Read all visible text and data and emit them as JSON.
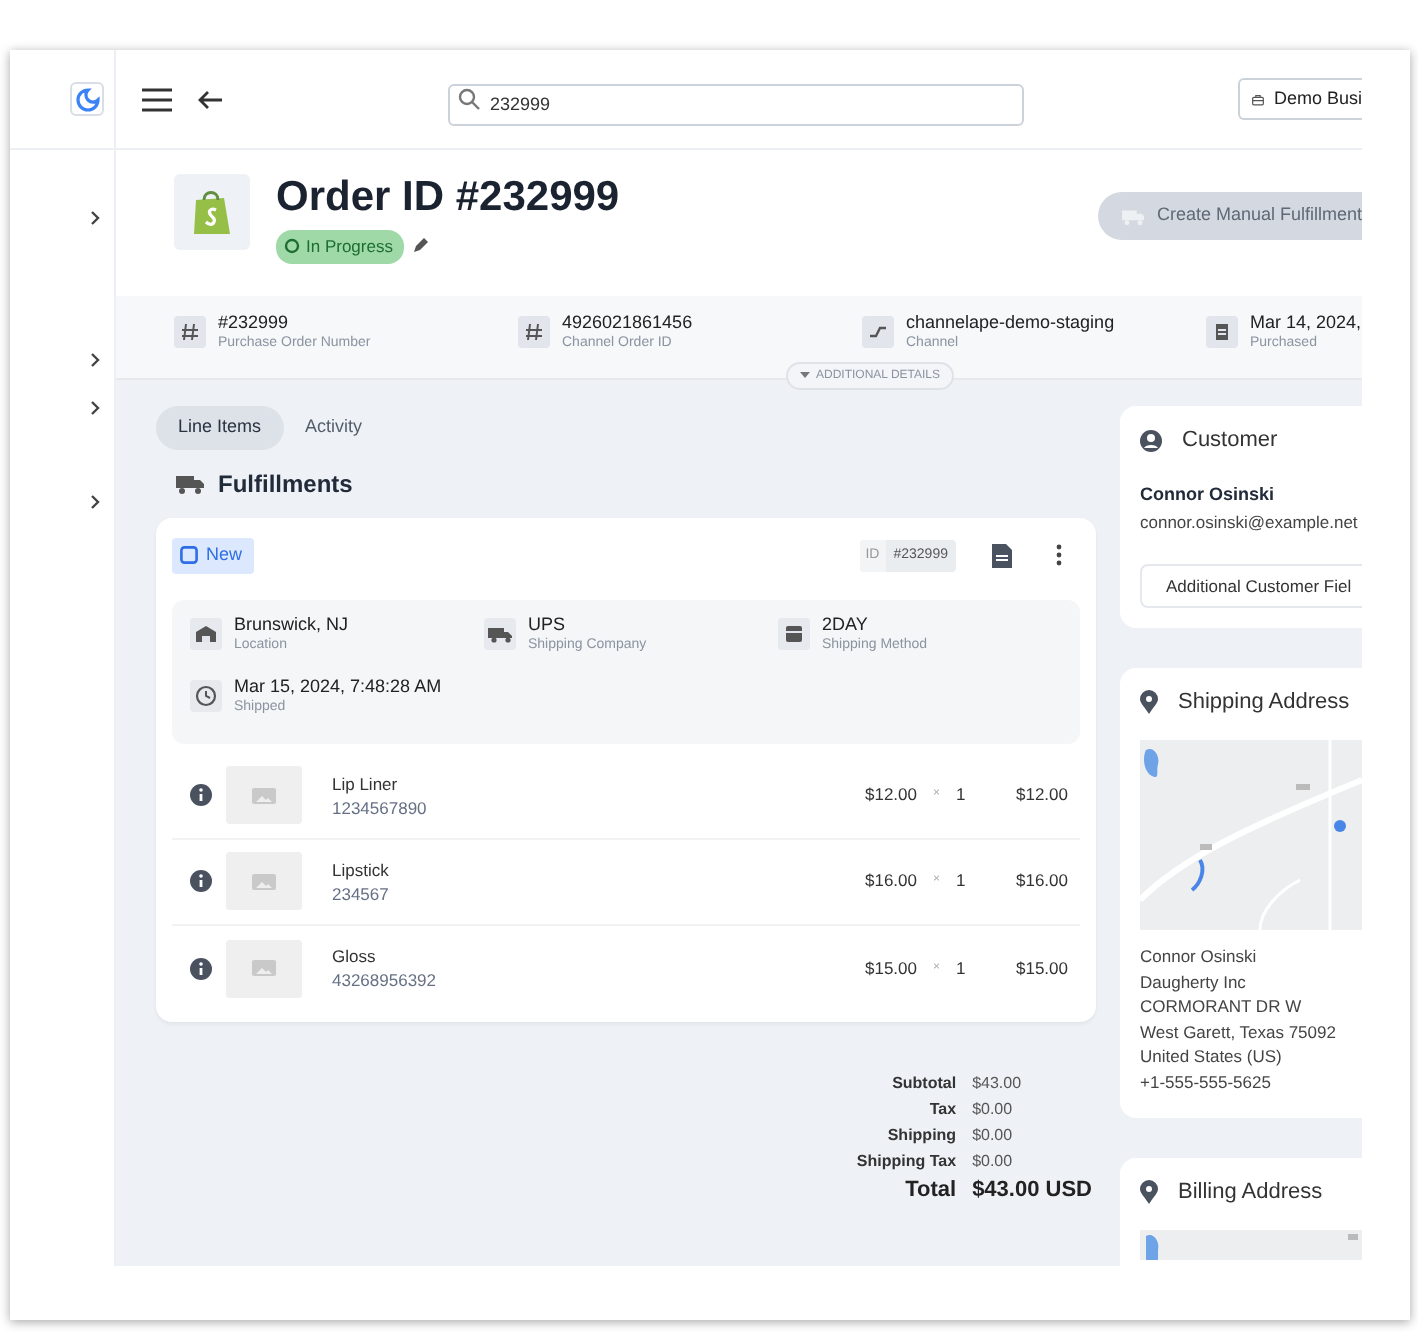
{
  "topbar": {
    "search": {
      "value": "232999"
    },
    "business_button": "Demo Busi"
  },
  "order": {
    "title": "Order ID #232999",
    "status": "In Progress",
    "create_button": {
      "label": "Create Manual Fulfillment",
      "disabled": true
    }
  },
  "details": [
    {
      "kind": "hash",
      "value": "#232999",
      "label": "Purchase Order Number"
    },
    {
      "kind": "hash",
      "value": "4926021861456",
      "label": "Channel Order ID"
    },
    {
      "kind": "channel",
      "value": "channelape-demo-staging",
      "label": "Channel"
    },
    {
      "kind": "date",
      "value": "Mar 14, 2024,",
      "label": "Purchased"
    }
  ],
  "additional_details": {
    "label": "ADDITIONAL DETAILS",
    "expanded": false
  },
  "tabs": [
    {
      "label": "Line Items",
      "selected": true
    },
    {
      "label": "Activity",
      "selected": false
    }
  ],
  "fulfillments": {
    "title": "Fulfillments",
    "status": "New",
    "id_label": "ID",
    "id": "#232999",
    "info": [
      {
        "kind": "location",
        "value": "Brunswick, NJ",
        "label": "Location"
      },
      {
        "kind": "truck",
        "value": "UPS",
        "label": "Shipping Company"
      },
      {
        "kind": "box",
        "value": "2DAY",
        "label": "Shipping Method"
      },
      {
        "kind": "clock",
        "value": "Mar 15, 2024, 7:48:28 AM",
        "label": "Shipped"
      }
    ],
    "line_items": [
      {
        "name": "Lip Liner",
        "sku": "1234567890",
        "price": "$12.00",
        "times": "×",
        "qty": "1",
        "total": "$12.00"
      },
      {
        "name": "Lipstick",
        "sku": "234567",
        "price": "$16.00",
        "times": "×",
        "qty": "1",
        "total": "$16.00"
      },
      {
        "name": "Gloss",
        "sku": "43268956392",
        "price": "$15.00",
        "times": "×",
        "qty": "1",
        "total": "$15.00"
      }
    ]
  },
  "totals": [
    {
      "label": "Subtotal",
      "value": "$43.00",
      "kind": "line"
    },
    {
      "label": "Tax",
      "value": "$0.00",
      "kind": "line"
    },
    {
      "label": "Shipping",
      "value": "$0.00",
      "kind": "line"
    },
    {
      "label": "Shipping Tax",
      "value": "$0.00",
      "kind": "line"
    },
    {
      "label": "Total",
      "value": "$43.00 USD",
      "kind": "grand"
    }
  ],
  "customer": {
    "title": "Customer",
    "name": "Connor Osinski",
    "email": "connor.osinski@example.net",
    "button": "Additional Customer Fiel"
  },
  "shipping_address": {
    "title": "Shipping Address",
    "lines": [
      "Connor Osinski",
      "Daugherty Inc",
      "CORMORANT DR W",
      "West Garett, Texas 75092",
      "United States (US)",
      "+1-555-555-5625"
    ]
  },
  "billing_address": {
    "title": "Billing Address"
  }
}
